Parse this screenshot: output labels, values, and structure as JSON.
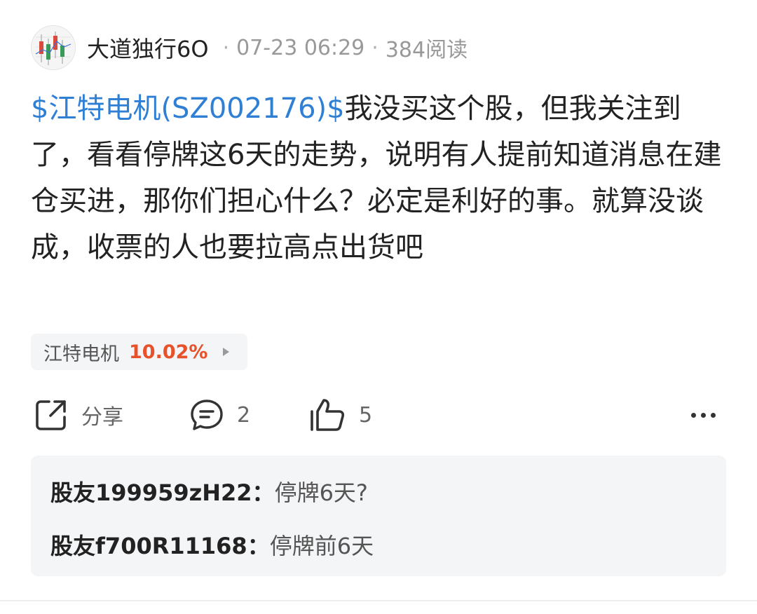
{
  "post": {
    "username": "大道独行6O",
    "date": "07-23 06:29",
    "reads": "384阅读",
    "separator": "·",
    "stock_tag": "$江特电机(SZ002176)$",
    "content": "我没买这个股，但我关注到了，看看停牌这6天的走势，说明有人提前知道消息在建仓买进，那你们担心什么？必定是利好的事。就算没谈成，收票的人也要拉高点出货吧"
  },
  "stock_chip": {
    "name": "江特电机",
    "change": "10.02%",
    "change_color": "#e8522a"
  },
  "actions": {
    "share_label": "分享",
    "comment_count": "2",
    "like_count": "5"
  },
  "comments": [
    {
      "author": "股友199959zH22",
      "sep": "：",
      "text": "停牌6天?"
    },
    {
      "author": "股友f700R11168",
      "sep": "：",
      "text": "停牌前6天"
    }
  ],
  "colors": {
    "link": "#2f7fd5",
    "rise": "#e8522a",
    "comment_bg": "#f4f5f7"
  },
  "icons": [
    "avatar-chart-image",
    "share-icon",
    "comment-icon",
    "like-icon",
    "more-icon",
    "chevron-right-icon"
  ]
}
